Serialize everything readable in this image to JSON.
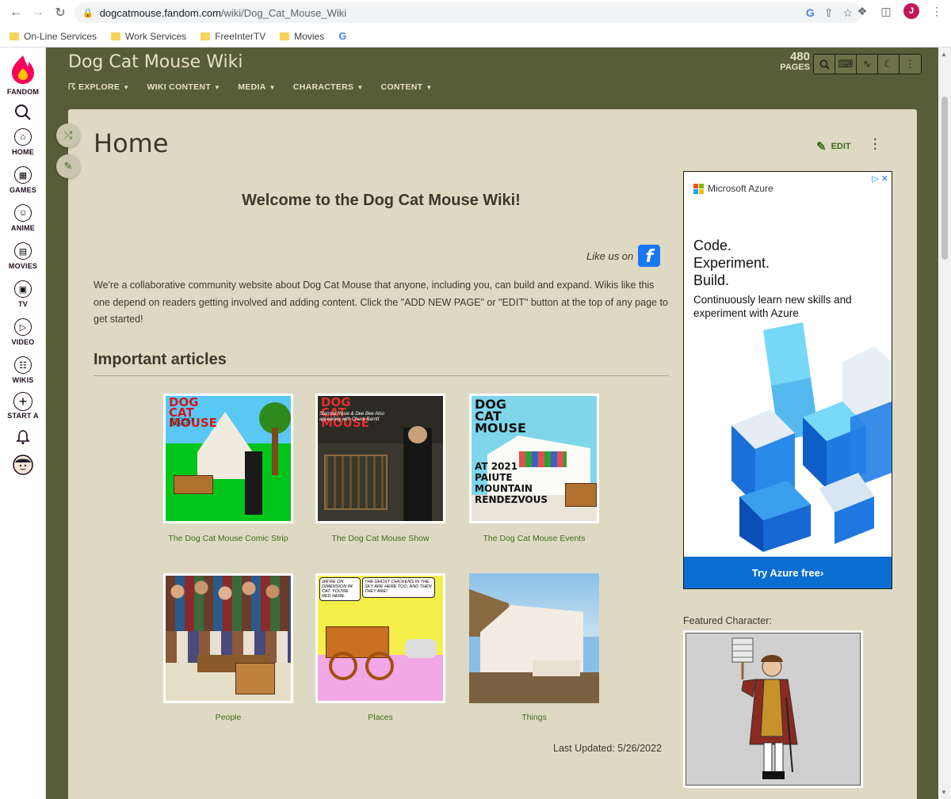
{
  "browser": {
    "url_domain": "dogcatmouse.fandom.com",
    "url_path": "/wiki/Dog_Cat_Mouse_Wiki",
    "profile_initial": "J",
    "bookmarks": [
      {
        "label": "On-Line Services"
      },
      {
        "label": "Work Services"
      },
      {
        "label": "FreeInterTV"
      },
      {
        "label": "Movies"
      }
    ]
  },
  "rail": {
    "brand": "FANDOM",
    "items": [
      {
        "label": "HOME",
        "icon": "home-icon"
      },
      {
        "label": "GAMES",
        "icon": "gamepad-icon"
      },
      {
        "label": "ANIME",
        "icon": "anime-icon"
      },
      {
        "label": "MOVIES",
        "icon": "movie-icon"
      },
      {
        "label": "TV",
        "icon": "tv-icon"
      },
      {
        "label": "VIDEO",
        "icon": "video-icon"
      },
      {
        "label": "WIKIS",
        "icon": "book-icon"
      },
      {
        "label": "START A",
        "icon": "plus-icon"
      }
    ]
  },
  "wiki": {
    "title": "Dog Cat Mouse Wiki",
    "pages_count": "480",
    "pages_label": "PAGES",
    "nav": [
      "EXPLORE",
      "WIKI CONTENT",
      "MEDIA",
      "CHARACTERS",
      "CONTENT"
    ]
  },
  "page": {
    "title": "Home",
    "edit_label": "EDIT",
    "welcome": "Welcome to the Dog Cat Mouse Wiki!",
    "like_us": "Like us on",
    "intro": "We're a collaborative community website about Dog Cat Mouse that anyone, including you, can build and expand. Wikis like this one depend on readers getting involved and adding content. Click the \"ADD NEW PAGE\" or \"EDIT\" button at the top of any page to get started!",
    "section_title": "Important articles",
    "articles": [
      {
        "caption": "The Dog Cat Mouse Comic Strip",
        "img_text": "DOG CAT MOUSE"
      },
      {
        "caption": "The Dog Cat Mouse Show",
        "img_text": "DOG CAT MOUSE"
      },
      {
        "caption": "The Dog Cat Mouse Events",
        "img_text": "DOG CAT MOUSE"
      },
      {
        "caption": "People"
      },
      {
        "caption": "Places"
      },
      {
        "caption": "Things"
      }
    ],
    "comic_sub": "BY CHUCK BARRITT",
    "show_sub": "Starring Rosie & Dee Bee Also appearing with Chuck Barritt",
    "events_sub": "AT 2021 PAIUTE MOUNTAIN RENDEZVOUS",
    "places_bubble_left": "WE'RE ON DIMENSION 84 CAT. YOU'RE RED HERE.",
    "places_bubble_right": "THE GHOST CHICKENS IN THE SKY ARE HERE TOO, AND THEN THEY ARE!",
    "last_updated": "Last Updated: 5/26/2022"
  },
  "ad": {
    "brand": "Microsoft Azure",
    "headline_1": "Code.",
    "headline_2": "Experiment.",
    "headline_3": "Build.",
    "subtext": "Continuously learn new skills and experiment with Azure",
    "cta": "Try Azure free›"
  },
  "featured": {
    "label": "Featured Character:"
  },
  "colors": {
    "wiki_bg": "#585d39",
    "card_bg": "#ddd9c3",
    "link": "#3f6e1a",
    "fandom_pink": "#fa005a"
  }
}
